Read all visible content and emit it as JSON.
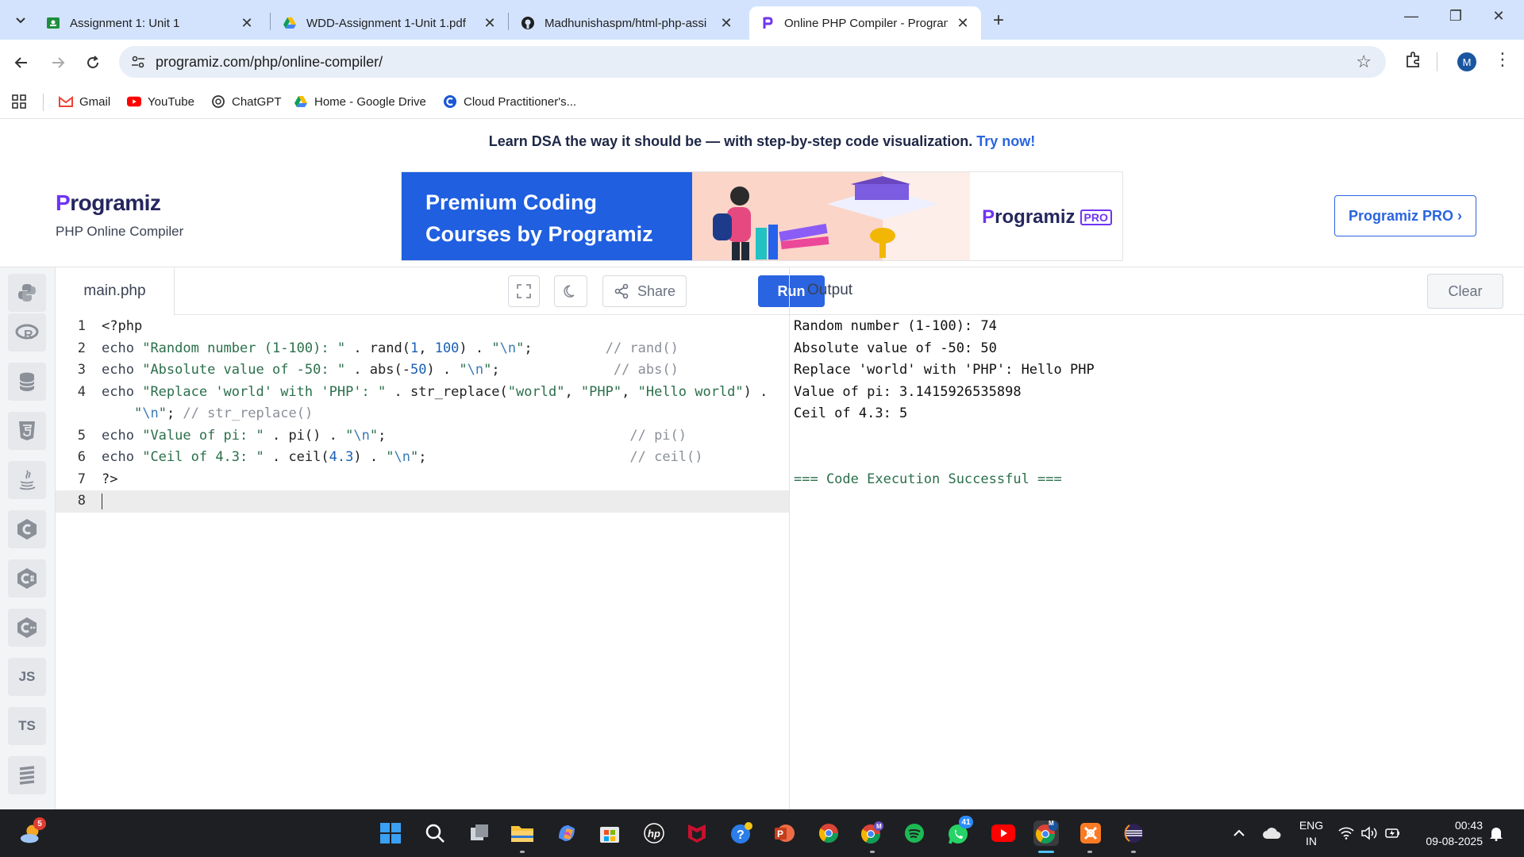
{
  "browser": {
    "tabs": [
      {
        "title": "Assignment 1: Unit 1",
        "icon": "google-classroom-icon",
        "active": false
      },
      {
        "title": "WDD-Assignment 1-Unit 1.pdf",
        "icon": "google-drive-icon",
        "active": false
      },
      {
        "title": "Madhunishaspm/html-php-assi",
        "icon": "github-icon",
        "active": false
      },
      {
        "title": "Online PHP Compiler - Program",
        "icon": "programiz-icon",
        "active": true
      }
    ],
    "url": "programiz.com/php/online-compiler/",
    "profile_initial": "M",
    "bookmarks": [
      {
        "label": "Gmail",
        "icon": "gmail-icon"
      },
      {
        "label": "YouTube",
        "icon": "youtube-icon"
      },
      {
        "label": "ChatGPT",
        "icon": "chatgpt-icon"
      },
      {
        "label": "Home - Google Drive",
        "icon": "google-drive-icon"
      },
      {
        "label": "Cloud Practitioner's...",
        "icon": "cloud-icon"
      }
    ]
  },
  "page": {
    "promo_text": "Learn DSA the way it should be — with step-by-step code visualization.",
    "promo_link": "Try now!",
    "brand_logo": "Programiz",
    "brand_subtitle": "PHP Online Compiler",
    "banner_title_1": "Premium Coding",
    "banner_title_2": "Courses by Programiz",
    "banner_logo": "Programiz",
    "banner_badge": "PRO",
    "pro_button": "Programiz PRO ›"
  },
  "languages": [
    {
      "name": "python-icon",
      "label": ""
    },
    {
      "name": "r-icon",
      "label": "R"
    },
    {
      "name": "sql-icon",
      "label": ""
    },
    {
      "name": "html-icon",
      "label": "5"
    },
    {
      "name": "java-icon",
      "label": ""
    },
    {
      "name": "c-icon",
      "label": "C"
    },
    {
      "name": "csharp-icon",
      "label": "C"
    },
    {
      "name": "cpp-icon",
      "label": "C"
    },
    {
      "name": "js-icon",
      "label": "JS"
    },
    {
      "name": "ts-icon",
      "label": "TS"
    },
    {
      "name": "more-icon",
      "label": ""
    }
  ],
  "editor": {
    "filename": "main.php",
    "share_label": "Share",
    "run_label": "Run",
    "lines": [
      {
        "n": "1",
        "text": "<?php"
      },
      {
        "n": "2",
        "text": "echo \"Random number (1-100): \" . rand(1, 100) . \"\\n\";         // rand()"
      },
      {
        "n": "3",
        "text": "echo \"Absolute value of -50: \" . abs(-50) . \"\\n\";              // abs()"
      },
      {
        "n": "4",
        "text": "echo \"Replace 'world' with 'PHP': \" . str_replace(\"world\", \"PHP\", \"Hello world\") ."
      },
      {
        "n": "",
        "text": "    \"\\n\"; // str_replace()"
      },
      {
        "n": "5",
        "text": "echo \"Value of pi: \" . pi() . \"\\n\";                              // pi()"
      },
      {
        "n": "6",
        "text": "echo \"Ceil of 4.3: \" . ceil(4.3) . \"\\n\";                         // ceil()"
      },
      {
        "n": "7",
        "text": "?>"
      },
      {
        "n": "8",
        "text": ""
      }
    ]
  },
  "output": {
    "title": "Output",
    "clear_label": "Clear",
    "lines": [
      "Random number (1-100): 74",
      "Absolute value of -50: 50",
      "Replace 'world' with 'PHP': Hello PHP",
      "Value of pi: 3.1415926535898",
      "Ceil of 4.3: 5",
      "",
      "",
      "=== Code Execution Successful ==="
    ]
  },
  "taskbar": {
    "weather_badge": "5",
    "whatsapp_badge": "41",
    "chrome_profile_badge": "M",
    "lang_line1": "ENG",
    "lang_line2": "IN",
    "time": "00:43",
    "date": "09-08-2025"
  }
}
